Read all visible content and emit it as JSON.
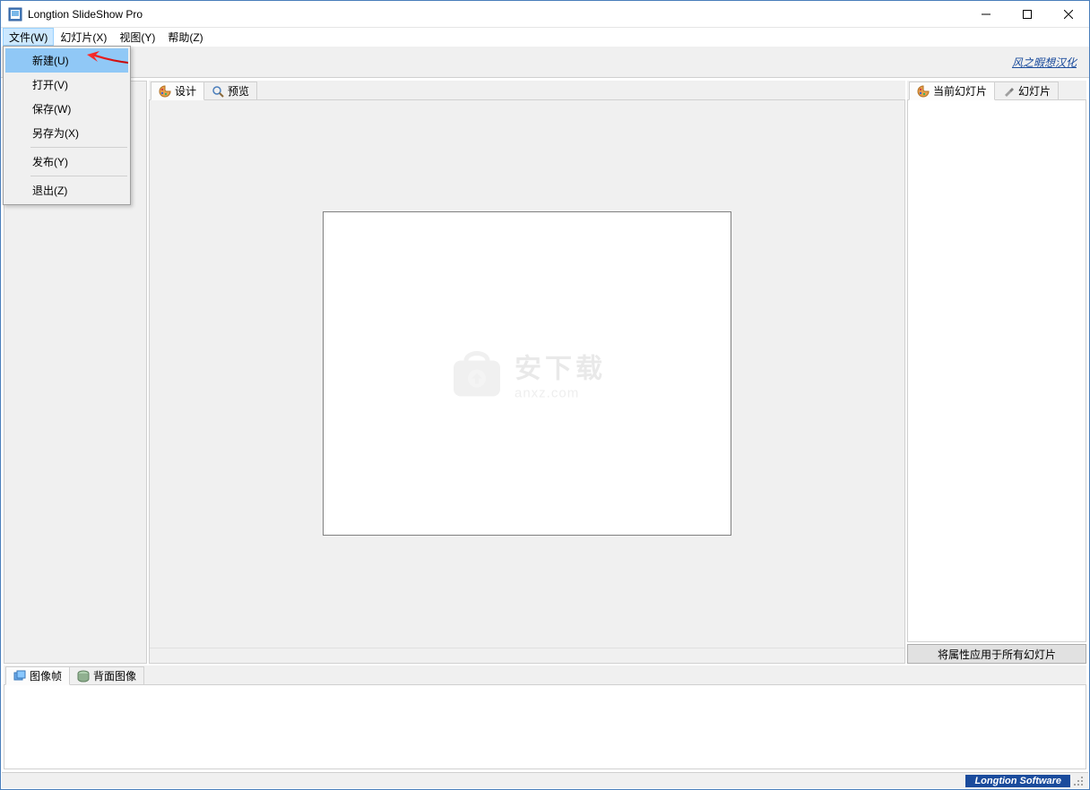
{
  "window": {
    "title": "Longtion SlideShow Pro"
  },
  "menubar": {
    "items": [
      {
        "label": "文件(W)",
        "active": true
      },
      {
        "label": "幻灯片(X)"
      },
      {
        "label": "视图(Y)"
      },
      {
        "label": "帮助(Z)"
      }
    ]
  },
  "file_menu": {
    "items": [
      {
        "label": "新建(U)",
        "highlighted": true
      },
      {
        "label": "打开(V)"
      },
      {
        "label": "保存(W)"
      },
      {
        "label": "另存为(X)"
      },
      {
        "sep": true
      },
      {
        "label": "发布(Y)"
      },
      {
        "sep": true
      },
      {
        "label": "退出(Z)"
      }
    ]
  },
  "toolbar": {
    "link_text": "风之暇想汉化"
  },
  "center_tabs": {
    "items": [
      {
        "label": "设计",
        "active": true
      },
      {
        "label": "预览"
      }
    ]
  },
  "right_tabs": {
    "items": [
      {
        "label": "当前幻灯片",
        "active": true
      },
      {
        "label": "幻灯片"
      }
    ]
  },
  "right_panel": {
    "apply_button": "将属性应用于所有幻灯片"
  },
  "bottom_tabs": {
    "items": [
      {
        "label": "图像帧",
        "active": true
      },
      {
        "label": "背面图像"
      }
    ]
  },
  "watermark": {
    "cn": "安下载",
    "en": "anxz.com"
  },
  "status": {
    "brand": "Longtion Software"
  }
}
